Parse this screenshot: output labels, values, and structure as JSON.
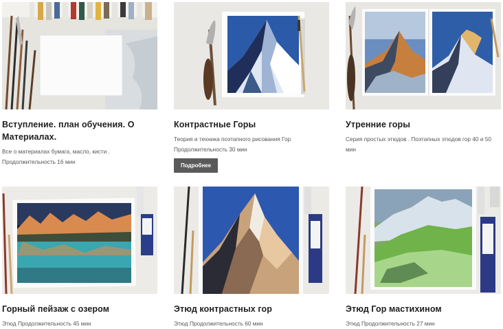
{
  "courses": [
    {
      "title": "Вступление. план обучения. О Материалах.",
      "description": "Все о материалах бумага, масло, кисти . Продолжительность 16 мин",
      "thumbnail_icon": "art-supplies-photo"
    },
    {
      "title": "Контрастные Горы",
      "description": "Теория и техника поэтапного рисования Гор Продолжительность 30 мин",
      "more_label": "Подробнее",
      "thumbnail_icon": "mountain-painting-photo"
    },
    {
      "title": "Утренние горы",
      "description": "Серия простых этюдов . Поэтапных этюдов гор 40 и 50 мин",
      "thumbnail_icon": "morning-mountains-photo"
    },
    {
      "title": "Горный пейзаж с озером",
      "description": "Этюд Продолжительность 45 мин",
      "thumbnail_icon": "mountain-lake-painting-photo"
    },
    {
      "title": "Этюд контрастных гор",
      "description": "Этюд Продолжительность 60 мин",
      "thumbnail_icon": "contrast-mountain-painting-photo"
    },
    {
      "title": "Этюд Гор мастихином",
      "description": "Этюд Продолжительность 27 мин",
      "thumbnail_icon": "palette-knife-mountain-photo"
    }
  ],
  "colors": {
    "button_bg": "#5a5a5a",
    "title_text": "#1e1e1e",
    "desc_text": "#555555"
  }
}
